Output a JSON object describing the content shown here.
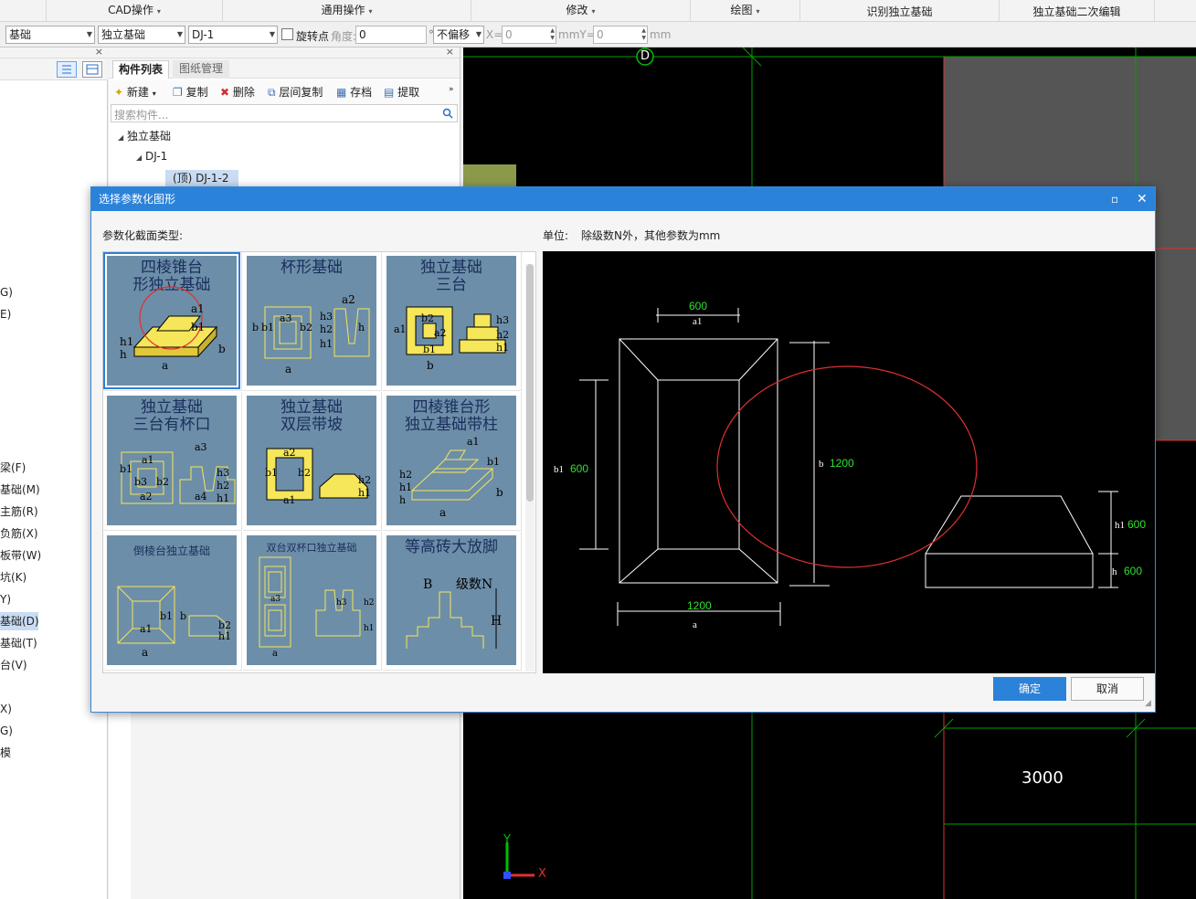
{
  "menubar": {
    "items": [
      {
        "label": "CAD操作",
        "caret": "▾"
      },
      {
        "label": "通用操作",
        "caret": "▾"
      },
      {
        "label": "修改",
        "caret": "▾"
      },
      {
        "label": "绘图",
        "caret": "▾"
      },
      {
        "label": "识别独立基础",
        "caret": ""
      },
      {
        "label": "独立基础二次编辑",
        "caret": ""
      }
    ]
  },
  "toolbar": {
    "floor_select": "基础",
    "type_select": "独立基础",
    "component_select": "DJ-1",
    "rotate_label": "旋转点",
    "angle_label": "角度:",
    "angle_value": "0",
    "degree_unit": "°",
    "offset_select": "不偏移",
    "x_label": "X=",
    "x_value": "0",
    "mmY_label": "mmY=",
    "y_value": "0",
    "mm_label": "mm"
  },
  "left_panel": {
    "items": [
      "G)",
      "E)",
      "梁(F)",
      "基础(M)",
      "主筋(R)",
      "负筋(X)",
      "板带(W)",
      "坑(K)",
      "Y)",
      "基础(D)",
      "基础(T)",
      "台(V)",
      "X)",
      "G)",
      "模"
    ],
    "selected_item": "基础(D)"
  },
  "component_panel": {
    "tabs": [
      "构件列表",
      "图纸管理"
    ],
    "actions": [
      "新建",
      "复制",
      "删除",
      "层间复制",
      "存档",
      "提取"
    ],
    "search_placeholder": "搜索构件...",
    "tree": {
      "root": "独立基础",
      "child": "DJ-1",
      "leaf": "(顶)  DJ-1-2"
    }
  },
  "canvas": {
    "axis_label": "D",
    "dimension": "3000",
    "x_axis": "X",
    "y_axis": "Y"
  },
  "dialog": {
    "title": "选择参数化图形",
    "section_label": "参数化截面类型:",
    "units_label": "单位:",
    "units_text": "除级数N外，其他参数为mm",
    "shapes": [
      {
        "title_line1": "四棱锥台",
        "title_line2": "形独立基础",
        "labels": [
          "a1",
          "b1",
          "h1",
          "h",
          "a",
          "b"
        ]
      },
      {
        "title_line1": "杯形基础",
        "title_line2": "",
        "labels": [
          "a2",
          "a3",
          "b2",
          "b1",
          "b",
          "h3",
          "h2",
          "h1",
          "h",
          "a"
        ]
      },
      {
        "title_line1": "独立基础",
        "title_line2": "三台",
        "labels": [
          "a1",
          "b2",
          "a2",
          "b1",
          "b",
          "h3",
          "h2",
          "h1"
        ]
      },
      {
        "title_line1": "独立基础",
        "title_line2": "三台有杯口",
        "labels": [
          "a1",
          "a3",
          "b1",
          "b3",
          "b2",
          "a2",
          "a4",
          "h3",
          "h2",
          "h1"
        ]
      },
      {
        "title_line1": "独立基础",
        "title_line2": "双层带坡",
        "labels": [
          "a2",
          "b1",
          "b2",
          "a1",
          "h2",
          "h1"
        ]
      },
      {
        "title_line1": "四棱锥台形",
        "title_line2": "独立基础带柱",
        "labels": [
          "a1",
          "b1",
          "h2",
          "h1",
          "h",
          "a",
          "b"
        ]
      },
      {
        "title_line1": "倒棱台独立基础",
        "title_line2": "",
        "labels": [
          "a1",
          "b1",
          "b",
          "b2",
          "h1",
          "a"
        ]
      },
      {
        "title_line1": "双台双杯口独立基础",
        "title_line2": "",
        "labels": [
          "a3",
          "h3",
          "h2",
          "h1",
          "a"
        ]
      },
      {
        "title_line1": "等高砖大放脚",
        "title_line2": "",
        "labels": [
          "B",
          "级数N",
          "H"
        ]
      }
    ],
    "preview": {
      "top_dim_value": "600",
      "top_dim_name": "a1",
      "left_dim_name": "b1",
      "left_dim_value": "600",
      "right_dim_name": "b",
      "right_dim_value": "1200",
      "bottom_dim_value": "1200",
      "bottom_dim_name": "a",
      "section_h1_name": "h1",
      "section_h1_value": "600",
      "section_h_name": "h",
      "section_h_value": "600"
    },
    "ok_label": "确定",
    "cancel_label": "取消"
  },
  "colors": {
    "dialog_title_bg": "#2b82d9",
    "thumb_bg": "#6d8ea8",
    "cad_green": "#00c000",
    "cad_red": "#e03030",
    "dim_value_green": "#2fe22f"
  }
}
